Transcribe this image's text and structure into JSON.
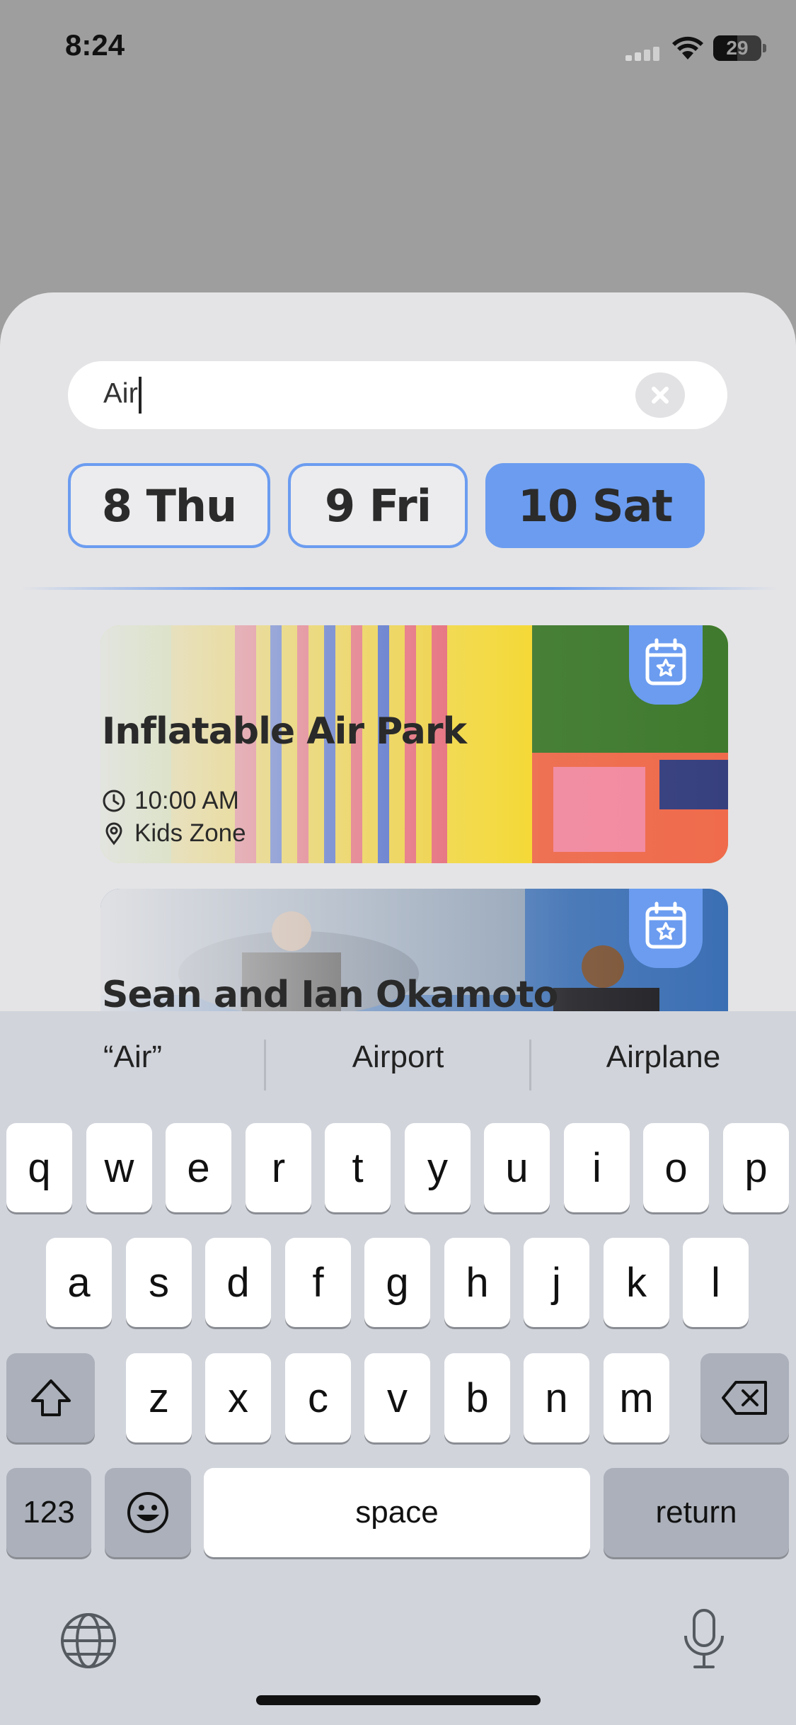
{
  "status_bar": {
    "time": "8:24",
    "battery": "29"
  },
  "search": {
    "value": "Air"
  },
  "days": [
    {
      "label": "8 Thu",
      "selected": false
    },
    {
      "label": "9 Fri",
      "selected": false
    },
    {
      "label": "10 Sat",
      "selected": true
    }
  ],
  "events": [
    {
      "title": "Inflatable Air Park",
      "time": "10:00 AM",
      "location": "Kids Zone"
    },
    {
      "title": "Sean and Ian Okamoto"
    }
  ],
  "keyboard": {
    "suggestions": [
      "“Air”",
      "Airport",
      "Airplane"
    ],
    "row1": [
      "q",
      "w",
      "e",
      "r",
      "t",
      "y",
      "u",
      "i",
      "o",
      "p"
    ],
    "row2": [
      "a",
      "s",
      "d",
      "f",
      "g",
      "h",
      "j",
      "k",
      "l"
    ],
    "row3": [
      "z",
      "x",
      "c",
      "v",
      "b",
      "n",
      "m"
    ],
    "numbers_label": "123",
    "space_label": "space",
    "return_label": "return"
  },
  "colors": {
    "accent": "#6b9cf0",
    "sheet": "#e4e4e6",
    "backdrop": "#9e9e9e"
  }
}
